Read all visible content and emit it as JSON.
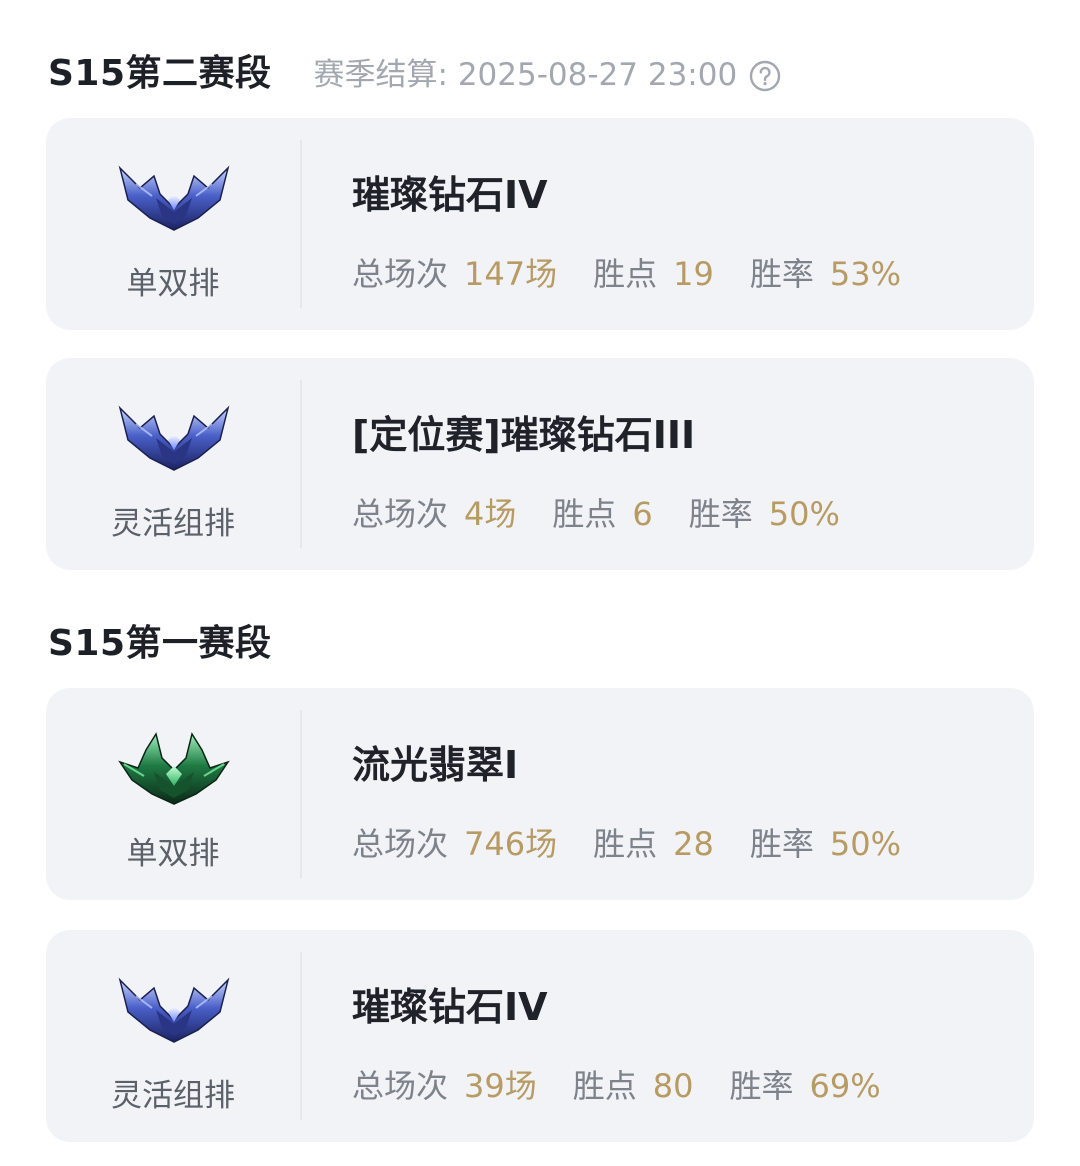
{
  "colors": {
    "accent_gold": "#b89a63",
    "card_bg": "#f1f3f7",
    "muted_text": "#a3a8b0"
  },
  "seasons": [
    {
      "title": "S15第二赛段",
      "settle_text": "赛季结算: 2025-08-27 23:00",
      "help_icon": "question-circle-icon",
      "cards": [
        {
          "emblem": "diamond-emblem-icon",
          "queue": "单双排",
          "rank": "璀璨钻石IV",
          "stats": {
            "games_label": "总场次",
            "games_value": "147场",
            "lp_label": "胜点",
            "lp_value": "19",
            "wr_label": "胜率",
            "wr_value": "53%"
          }
        },
        {
          "emblem": "diamond-emblem-icon",
          "queue": "灵活组排",
          "rank": "[定位赛]璀璨钻石III",
          "stats": {
            "games_label": "总场次",
            "games_value": "4场",
            "lp_label": "胜点",
            "lp_value": "6",
            "wr_label": "胜率",
            "wr_value": "50%"
          }
        }
      ]
    },
    {
      "title": "S15第一赛段",
      "cards": [
        {
          "emblem": "emerald-emblem-icon",
          "queue": "单双排",
          "rank": "流光翡翠I",
          "stats": {
            "games_label": "总场次",
            "games_value": "746场",
            "lp_label": "胜点",
            "lp_value": "28",
            "wr_label": "胜率",
            "wr_value": "50%"
          }
        },
        {
          "emblem": "diamond-emblem-icon",
          "queue": "灵活组排",
          "rank": "璀璨钻石IV",
          "stats": {
            "games_label": "总场次",
            "games_value": "39场",
            "lp_label": "胜点",
            "lp_value": "80",
            "wr_label": "胜率",
            "wr_value": "69%"
          }
        }
      ]
    }
  ]
}
